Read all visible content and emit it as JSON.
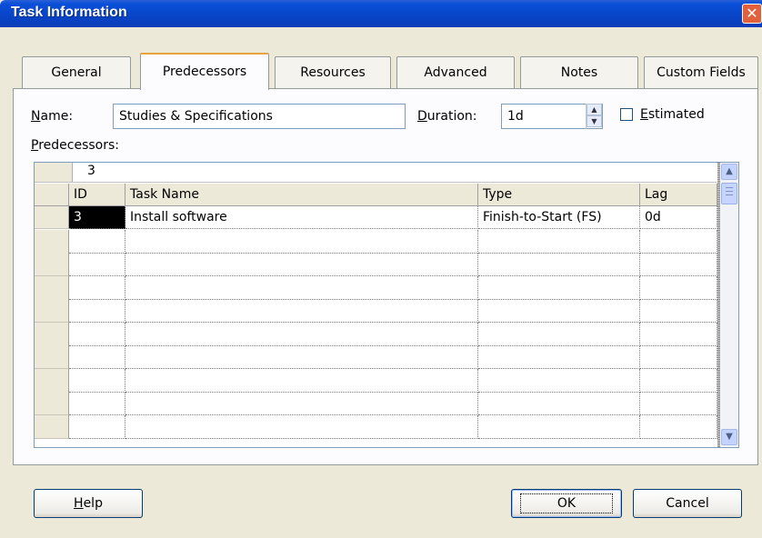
{
  "window": {
    "title": "Task Information",
    "close_glyph": "✕"
  },
  "tabs": [
    {
      "label": "General"
    },
    {
      "label": "Predecessors",
      "active": true
    },
    {
      "label": "Resources"
    },
    {
      "label": "Advanced"
    },
    {
      "label": "Notes"
    },
    {
      "label": "Custom Fields"
    }
  ],
  "form": {
    "name_label_prefix": "N",
    "name_label_rest": "ame:",
    "name_value": "Studies & Specifications",
    "duration_label_prefix": "D",
    "duration_label_rest": "uration:",
    "duration_value": "1d",
    "estimated_label_prefix": "E",
    "estimated_label_rest": "stimated",
    "estimated_checked": false,
    "predecessors_label_prefix": "P",
    "predecessors_label_rest": "redecessors:"
  },
  "grid": {
    "entry_value": "3",
    "columns": [
      "ID",
      "Task Name",
      "Type",
      "Lag"
    ],
    "rows": [
      {
        "id": "3",
        "task_name": "Install software",
        "type": "Finish-to-Start (FS)",
        "lag": "0d"
      }
    ]
  },
  "buttons": {
    "help_prefix": "H",
    "help_rest": "elp",
    "ok": "OK",
    "cancel": "Cancel"
  },
  "icons": {
    "scroll_up": "▲",
    "scroll_down": "▼",
    "spin_up": "▲",
    "spin_down": "▼"
  }
}
